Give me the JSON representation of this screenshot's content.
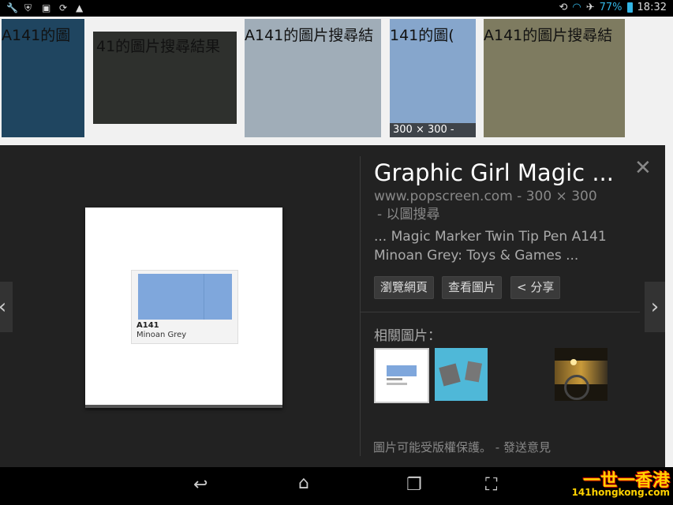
{
  "status_bar": {
    "icons": [
      "wrench-icon",
      "shield-icon",
      "image-icon",
      "sync-icon",
      "warning-icon"
    ],
    "battery_percent": "77%",
    "time": "18:32"
  },
  "results_strip": {
    "thumbnails": [
      {
        "text": "A141的圖",
        "color": "#1f4560",
        "dim": ""
      },
      {
        "text": "41的圖片搜尋結果",
        "color": "#2e302d",
        "dim": ""
      },
      {
        "text": "A141的圖片搜尋結",
        "color": "#a0adb8",
        "dim": ""
      },
      {
        "text": "141的圖(",
        "color": "#86a6cc",
        "dim": "300 × 300 -"
      },
      {
        "text": "A141的圖片搜尋結",
        "color": "#7e7b60",
        "dim": ""
      }
    ]
  },
  "detail": {
    "title": "Graphic Girl Magic ...",
    "source": "www.popscreen.com - 300 × 300",
    "search_by_image": "- 以圖搜尋",
    "snippet_line1": "... Magic Marker Twin Tip Pen A141",
    "snippet_line2": "Minoan Grey: Toys & Games ...",
    "buttons": {
      "visit_page": "瀏覽網頁",
      "view_image": "查看圖片",
      "share": "< 分享"
    },
    "related_label": "相關圖片：",
    "copyright_note": "圖片可能受版權保護。 - 發送意見",
    "preview": {
      "code": "A141",
      "name": "Minoan Grey",
      "swatch_color": "#7fa7dc"
    }
  },
  "watermark": {
    "title": "一世一香港",
    "site": "141hongkong.com"
  }
}
